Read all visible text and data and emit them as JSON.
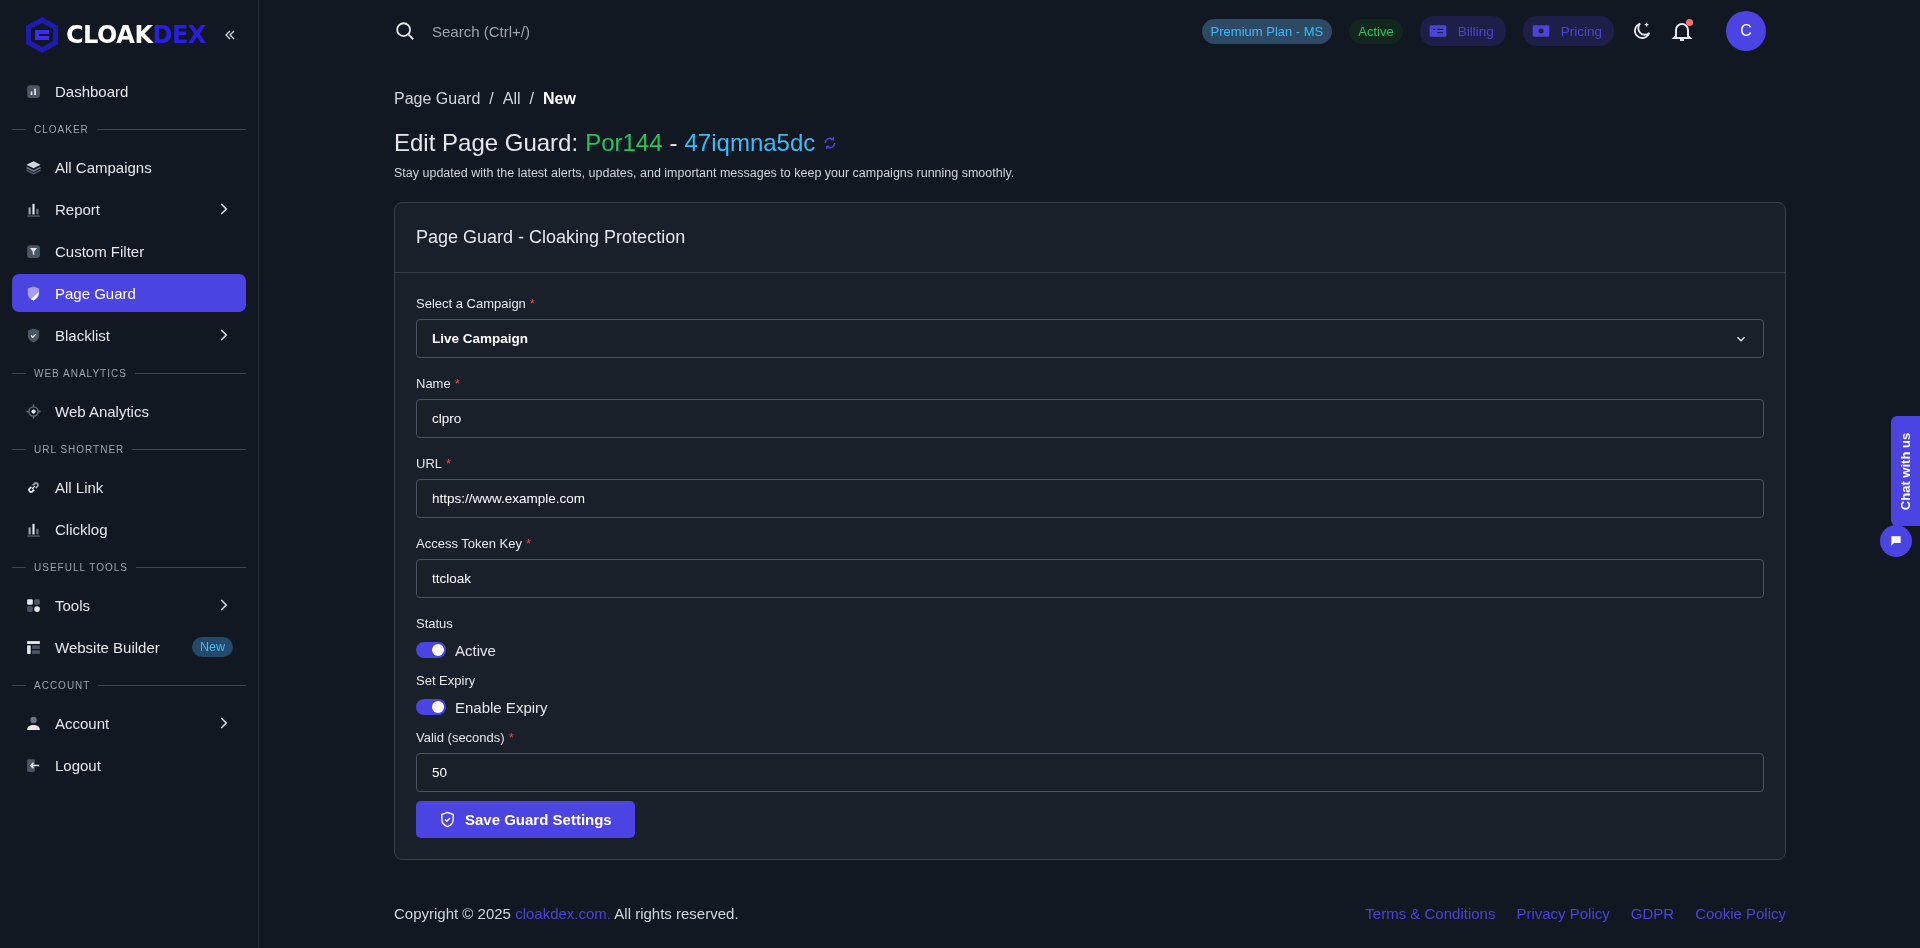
{
  "sidebar": {
    "logo": {
      "primary": "CLOAK",
      "accent": "DEX"
    },
    "items": [
      {
        "kind": "item",
        "label": "Dashboard",
        "selected": false,
        "has_submenu": false
      },
      {
        "kind": "section",
        "label": "CLOAKER"
      },
      {
        "kind": "item",
        "label": "All Campaigns",
        "selected": false,
        "has_submenu": false
      },
      {
        "kind": "item",
        "label": "Report",
        "selected": false,
        "has_submenu": true
      },
      {
        "kind": "item",
        "label": "Custom Filter",
        "selected": false,
        "has_submenu": false
      },
      {
        "kind": "item",
        "label": "Page Guard",
        "selected": true,
        "has_submenu": false
      },
      {
        "kind": "item",
        "label": "Blacklist",
        "selected": false,
        "has_submenu": true
      },
      {
        "kind": "section",
        "label": "WEB ANALYTICS"
      },
      {
        "kind": "item",
        "label": "Web Analytics",
        "selected": false,
        "has_submenu": false
      },
      {
        "kind": "section",
        "label": "URL SHORTNER"
      },
      {
        "kind": "item",
        "label": "All Link",
        "selected": false,
        "has_submenu": false
      },
      {
        "kind": "item",
        "label": "Clicklog",
        "selected": false,
        "has_submenu": false
      },
      {
        "kind": "section",
        "label": "USEFULL TOOLS"
      },
      {
        "kind": "item",
        "label": "Tools",
        "selected": false,
        "has_submenu": true
      },
      {
        "kind": "item",
        "label": "Website Builder",
        "selected": false,
        "has_submenu": false,
        "badge": "New"
      },
      {
        "kind": "section",
        "label": "ACCOUNT"
      },
      {
        "kind": "item",
        "label": "Account",
        "selected": false,
        "has_submenu": true
      },
      {
        "kind": "item",
        "label": "Logout",
        "selected": false,
        "has_submenu": false
      }
    ]
  },
  "header": {
    "search": {
      "placeholder": "Search (Ctrl+/)"
    },
    "plan_badge": "Premium Plan - MS",
    "status_badge": "Active",
    "buttons": [
      {
        "label": "Billing"
      },
      {
        "label": "Pricing"
      }
    ],
    "has_notification": true,
    "avatar": "C"
  },
  "breadcrumb": {
    "separator": "/",
    "items": [
      {
        "label": "Page Guard",
        "current": false
      },
      {
        "label": "All",
        "current": false
      },
      {
        "label": "New",
        "current": true
      }
    ]
  },
  "title": {
    "prefix": "Edit Page Guard:",
    "name": "Por144",
    "separator": "-",
    "code": "47iqmna5dc"
  },
  "subtitle": "Stay updated with the latest alerts, updates, and important messages to keep your campaigns running smoothly.",
  "card": {
    "title": "Page Guard - Cloaking Protection",
    "fields": [
      {
        "kind": "select",
        "label": "Select a Campaign",
        "required_mark": "*",
        "value": "Live Campaign"
      },
      {
        "kind": "text",
        "label": "Name",
        "required_mark": "*",
        "value": "clpro"
      },
      {
        "kind": "text",
        "label": "URL",
        "required_mark": "*",
        "value": "https://www.example.com"
      },
      {
        "kind": "text",
        "label": "Access Token Key",
        "required_mark": "*",
        "value": "ttcloak"
      },
      {
        "kind": "toggle",
        "label": "Status",
        "toggle_label": "Active",
        "on": true
      },
      {
        "kind": "toggle",
        "label": "Set Expiry",
        "toggle_label": "Enable Expiry",
        "on": true
      },
      {
        "kind": "text",
        "label": "Valid (seconds)",
        "required_mark": "*",
        "value": "50"
      }
    ],
    "submit": "Save Guard Settings"
  },
  "footer": {
    "copyright": {
      "before": "Copyright © 2025",
      "link": "cloakdex.com.",
      "after": "All rights reserved."
    },
    "links": [
      "Terms & Conditions",
      "Privacy Policy",
      "GDPR",
      "Cookie Policy"
    ]
  },
  "chat": {
    "label": "Chat with us"
  }
}
